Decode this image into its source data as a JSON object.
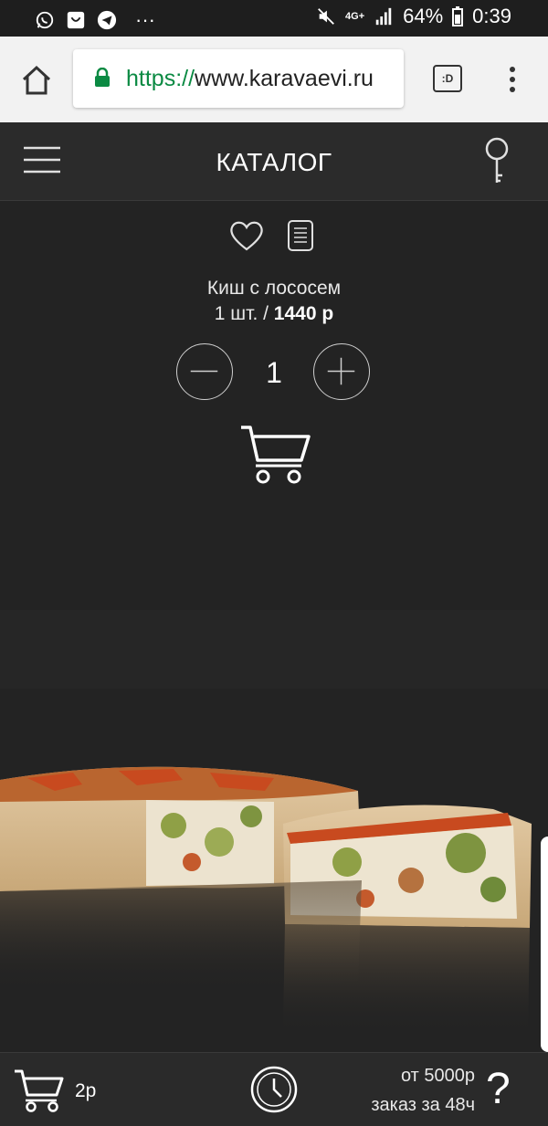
{
  "status_bar": {
    "network": "4G+",
    "battery": "64%",
    "time": "0:39",
    "more": "···"
  },
  "browser": {
    "url_scheme": "https://",
    "url_host": "www.karavaevi.ru",
    "tabs_label": ":D"
  },
  "header": {
    "title": "КАТАЛОГ"
  },
  "product": {
    "name": "Киш с лососем",
    "unit": "1 шт. /",
    "price": "1440 р",
    "quantity": "1"
  },
  "footer": {
    "cart_count": "2р",
    "min_order": "от 5000р",
    "lead_time": "заказ за 48ч",
    "help": "?"
  },
  "colors": {
    "accent_green": "#0b8a43",
    "bg_dark": "#232323"
  }
}
